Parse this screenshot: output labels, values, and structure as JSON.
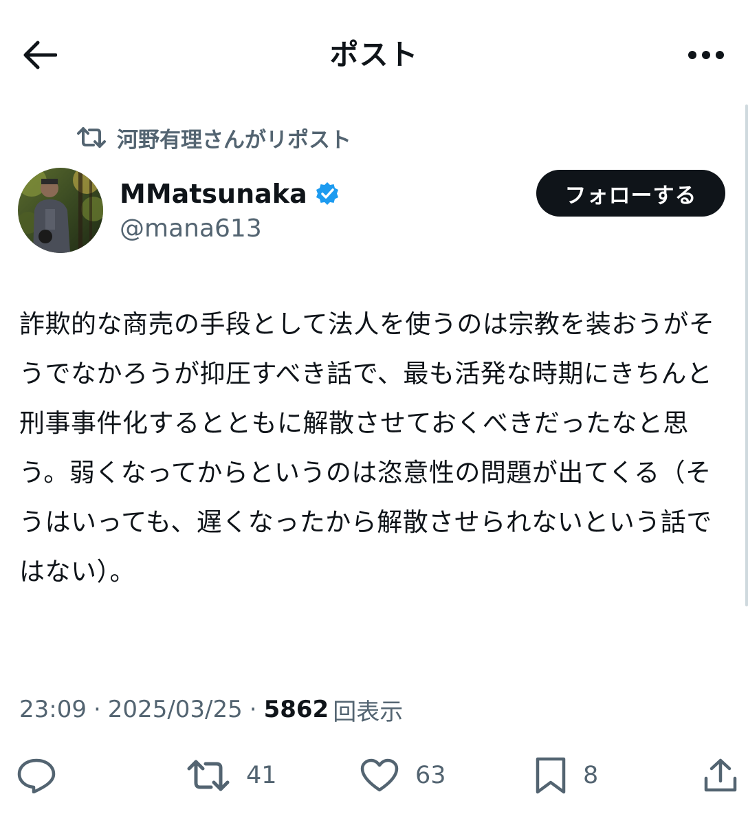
{
  "header": {
    "title": "ポスト",
    "back_icon": "arrow-left-icon",
    "more_icon": "more-horizontal-icon"
  },
  "repost_context": {
    "icon": "repost-icon",
    "text": "河野有理さんがリポスト"
  },
  "author": {
    "display_name": "MMatsunaka",
    "handle": "@mana613",
    "verified": true,
    "verified_color": "#1d9bf0"
  },
  "follow_button": {
    "label": "フォローする"
  },
  "tweet": {
    "text": "詐欺的な商売の手段として法人を使うのは宗教を装おうがそうでなかろうが抑圧すべき話で、最も活発な時期にきちんと刑事事件化するとともに解散させておくべきだったなと思う。弱くなってからというのは恣意性の問題が出てくる（そうはいっても、遅くなったから解散させられないという話ではない）。"
  },
  "meta": {
    "time": "23:09",
    "separator": "·",
    "date": "2025/03/25",
    "views_count": "5862",
    "views_label": "回表示"
  },
  "actions": {
    "reply": {
      "icon": "reply-icon"
    },
    "repost": {
      "icon": "repost-icon",
      "count": "41"
    },
    "like": {
      "icon": "heart-icon",
      "count": "63"
    },
    "bookmark": {
      "icon": "bookmark-icon",
      "count": "8"
    },
    "share": {
      "icon": "share-icon"
    }
  },
  "colors": {
    "text_primary": "#0f1419",
    "text_secondary": "#536471",
    "button_bg": "#0f1419",
    "button_text": "#ffffff"
  }
}
